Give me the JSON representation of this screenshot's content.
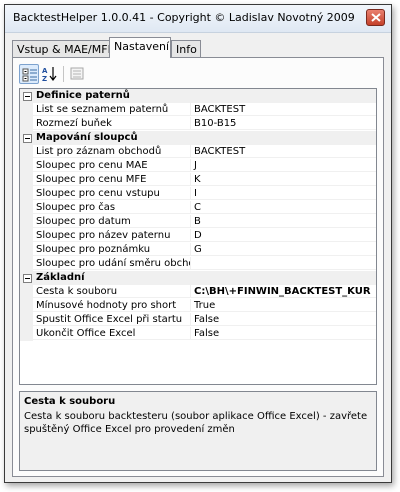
{
  "window": {
    "title": "BacktestHelper 1.0.0.41 - Copyright © Ladislav Novotný 2009"
  },
  "tabs": [
    {
      "label": "Vstup & MAE/MFE",
      "active": false
    },
    {
      "label": "Nastavení",
      "active": true
    },
    {
      "label": "Info",
      "active": false
    }
  ],
  "toolbar": {
    "categorized_icon": "categorized-view-icon",
    "alphabetical_icon": "alphabetical-sort-icon",
    "property_pages_icon": "property-pages-icon"
  },
  "grid": {
    "categories": [
      {
        "label": "Definice paternů",
        "rows": [
          {
            "name": "List se seznamem paternů",
            "value": "BACKTEST"
          },
          {
            "name": "Rozmezí buňek",
            "value": "B10-B15"
          }
        ]
      },
      {
        "label": "Mapování sloupců",
        "rows": [
          {
            "name": "List pro záznam obchodů",
            "value": "BACKTEST"
          },
          {
            "name": "Sloupec pro cenu MAE",
            "value": "J"
          },
          {
            "name": "Sloupec pro cenu MFE",
            "value": "K"
          },
          {
            "name": "Sloupec pro cenu vstupu",
            "value": "I"
          },
          {
            "name": "Sloupec pro čas",
            "value": "C"
          },
          {
            "name": "Sloupec pro datum",
            "value": "B"
          },
          {
            "name": "Sloupec pro název paternu",
            "value": "D"
          },
          {
            "name": "Sloupec pro poznámku",
            "value": "G"
          },
          {
            "name": "Sloupec pro udání směru obchodu",
            "value": ""
          }
        ]
      },
      {
        "label": "Základní",
        "rows": [
          {
            "name": "Cesta k souboru",
            "value": "C:\\BH\\+FINWIN_BACKTEST_KUR",
            "bold": true
          },
          {
            "name": "Mínusové hodnoty pro short",
            "value": "True"
          },
          {
            "name": "Spustit Office Excel při startu",
            "value": "False"
          },
          {
            "name": "Ukončit Office Excel",
            "value": "False"
          }
        ]
      }
    ]
  },
  "help": {
    "title": "Cesta k souboru",
    "description": "Cesta k souboru backtesteru (soubor aplikace Office Excel) - zavřete spuštěný Office Excel pro provedení změn"
  },
  "colors": {
    "titlebar": "#dfe8f3",
    "close_button": "#c4412a",
    "category_background": "#f0f0f0",
    "grid_border": "#828790"
  }
}
